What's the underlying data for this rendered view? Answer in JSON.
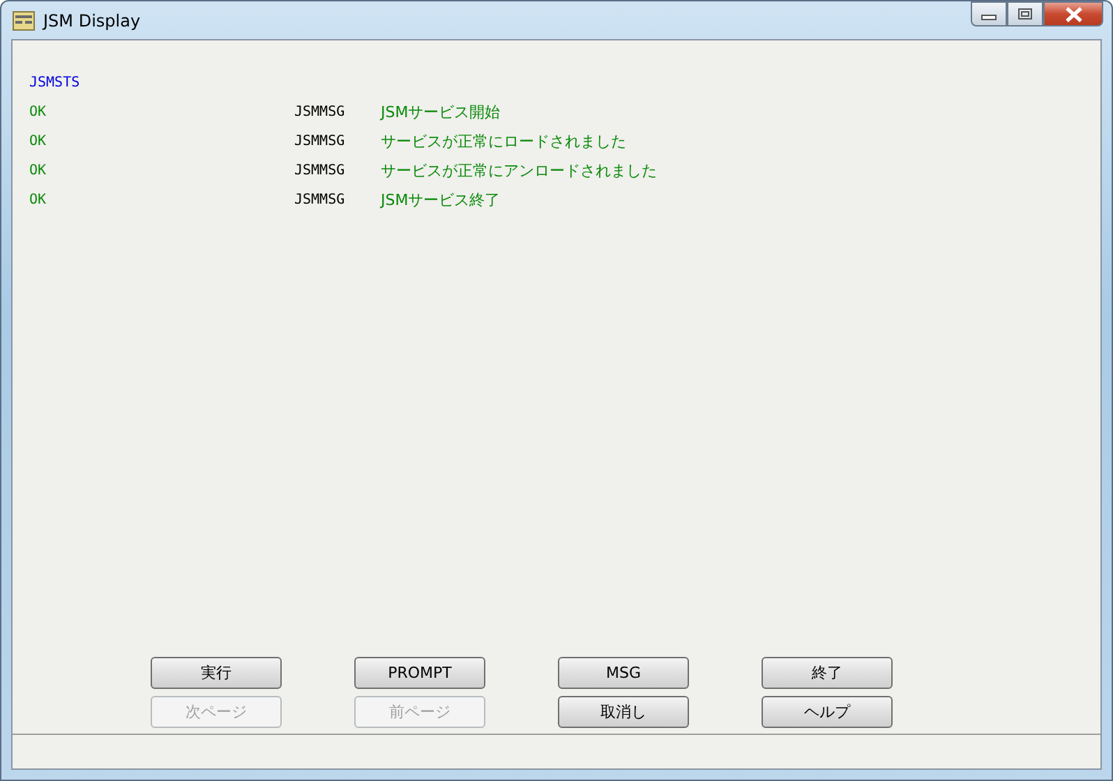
{
  "window": {
    "title": "JSM Display"
  },
  "header": {
    "text": "JSMSTS"
  },
  "rows": [
    {
      "status": "OK",
      "type": "JSMMSG",
      "message": "JSMサービス開始"
    },
    {
      "status": "OK",
      "type": "JSMMSG",
      "message": "サービスが正常にロードされました"
    },
    {
      "status": "OK",
      "type": "JSMMSG",
      "message": "サービスが正常にアンロードされました"
    },
    {
      "status": "OK",
      "type": "JSMMSG",
      "message": "JSMサービス終了"
    }
  ],
  "buttons": [
    {
      "label": "実行",
      "disabled": false
    },
    {
      "label": "PROMPT",
      "disabled": false
    },
    {
      "label": "MSG",
      "disabled": false
    },
    {
      "label": "終了",
      "disabled": false
    },
    {
      "label": "次ページ",
      "disabled": true
    },
    {
      "label": "前ページ",
      "disabled": true
    },
    {
      "label": "取消し",
      "disabled": false
    },
    {
      "label": "ヘルプ",
      "disabled": false
    }
  ]
}
